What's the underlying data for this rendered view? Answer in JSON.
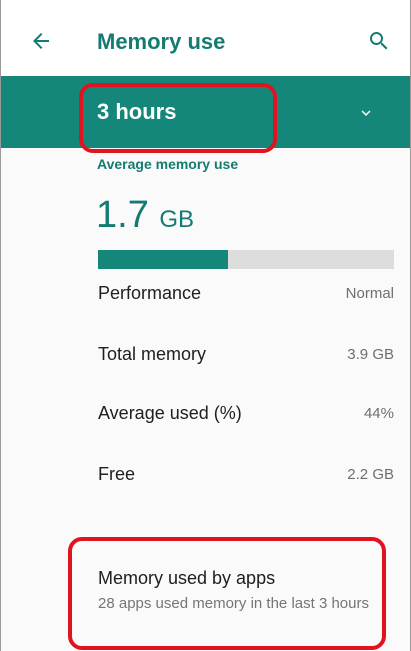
{
  "header": {
    "title": "Memory use"
  },
  "period": {
    "selected": "3 hours"
  },
  "average": {
    "label": "Average memory use",
    "value": "1.7",
    "unit": "GB",
    "bar_fraction": 0.44
  },
  "stats": [
    {
      "label": "Performance",
      "value": "Normal"
    },
    {
      "label": "Total memory",
      "value": "3.9 GB"
    },
    {
      "label": "Average used (%)",
      "value": "44%"
    },
    {
      "label": "Free",
      "value": "2.2 GB"
    }
  ],
  "apps": {
    "title": "Memory used by apps",
    "subtitle": "28 apps used memory in the last 3 hours"
  },
  "colors": {
    "accent": "#15867a",
    "accent_text": "#147b70",
    "highlight": "#e0141f"
  },
  "icons": {
    "back": "back-arrow-icon",
    "search": "search-icon",
    "dropdown": "chevron-down-icon"
  }
}
